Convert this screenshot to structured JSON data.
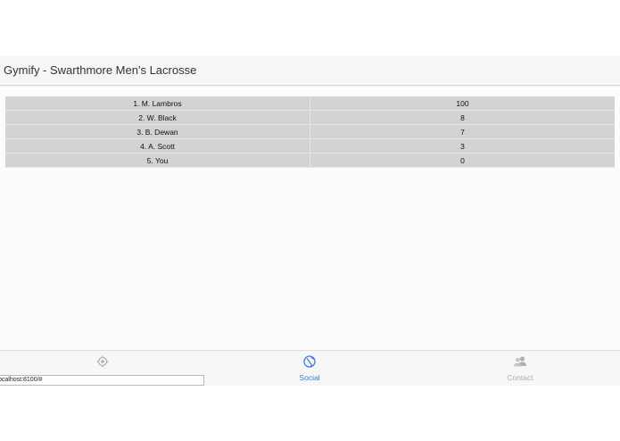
{
  "header": {
    "title": "Gymify - Swarthmore Men's Lacrosse"
  },
  "leaderboard": [
    {
      "name": "1. M. Lambros",
      "score": "100"
    },
    {
      "name": "2. W. Black",
      "score": "8"
    },
    {
      "name": "3. B. Dewan",
      "score": "7"
    },
    {
      "name": "4. A. Scott",
      "score": "3"
    },
    {
      "name": "5. You",
      "score": "0"
    }
  ],
  "tabs": [
    {
      "icon": "location-target-icon",
      "label": "",
      "active": false
    },
    {
      "icon": "globe-icon",
      "label": "Social",
      "active": true
    },
    {
      "icon": "contacts-icon",
      "label": "Contact",
      "active": false
    }
  ],
  "status_url": "ocalhost:8100/#",
  "colors": {
    "accent": "#3a7bd5",
    "row_bg": "#d3d3d3",
    "inactive": "#b0b0b0"
  }
}
